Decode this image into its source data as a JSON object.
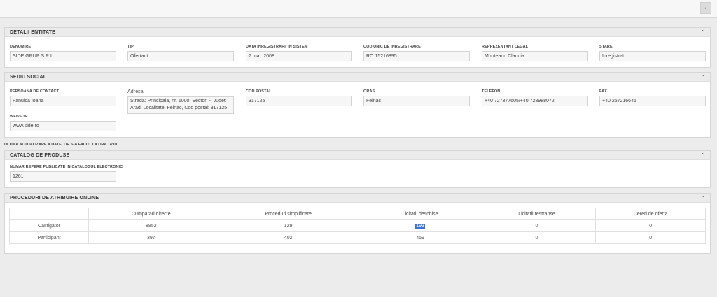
{
  "topbar": {
    "collapse_icon": "‹"
  },
  "entity": {
    "title": "DETALII ENTITATE",
    "fields": [
      {
        "label": "DENUMIRE",
        "value": "SIDE GRUP S.R.L."
      },
      {
        "label": "TIP",
        "value": "Ofertant"
      },
      {
        "label": "DATA INREGISTRARII IN SISTEM",
        "value": "7 mar. 2008"
      },
      {
        "label": "COD UNIC DE INREGISTRARE",
        "value": "RO 15216895"
      },
      {
        "label": "REPREZENTANT LEGAL",
        "value": "Munteanu Claudia"
      },
      {
        "label": "STARE",
        "value": "Inregistrat"
      }
    ]
  },
  "seat": {
    "title": "SEDIU SOCIAL",
    "contact": {
      "label": "PERSOANA DE CONTACT",
      "value": "Fanuica Ioana"
    },
    "address": {
      "label": "Adresa",
      "value": "Strada: Principala, nr. 1000, Sector: -, Judet: Arad, Localitate: Felnac, Cod postal: 317125"
    },
    "postal": {
      "label": "COD POSTAL",
      "value": "317125"
    },
    "city": {
      "label": "ORAS",
      "value": "Felnac"
    },
    "phone": {
      "label": "TELEFON",
      "value": "+40 727377605/+40 728988072"
    },
    "fax": {
      "label": "FAX",
      "value": "+40 257216645"
    },
    "website": {
      "label": "WEBSITE",
      "value": "www.side.ro"
    }
  },
  "update_note": "ULTIMA ACTUALIZARE A DATELOR S-A FACUT LA ORA 14:01",
  "catalog": {
    "title": "CATALOG DE PRODUSE",
    "label": "NUMAR REPERE PUBLICATE IN CATALOGUL ELECTRONIC",
    "value": "1261"
  },
  "procedures": {
    "title": "PROCEDURI DE ATRIBUIRE ONLINE",
    "columns": [
      "Cumparari directe",
      "Proceduri simplificate",
      "Licitatii deschise",
      "Licitatii restranse",
      "Cereri de oferta"
    ],
    "rows": [
      {
        "label": "Castigator",
        "values": [
          "8852",
          "129",
          "193",
          "0",
          "0"
        ]
      },
      {
        "label": "Participant",
        "values": [
          "397",
          "402",
          "459",
          "0",
          "0"
        ]
      }
    ]
  }
}
